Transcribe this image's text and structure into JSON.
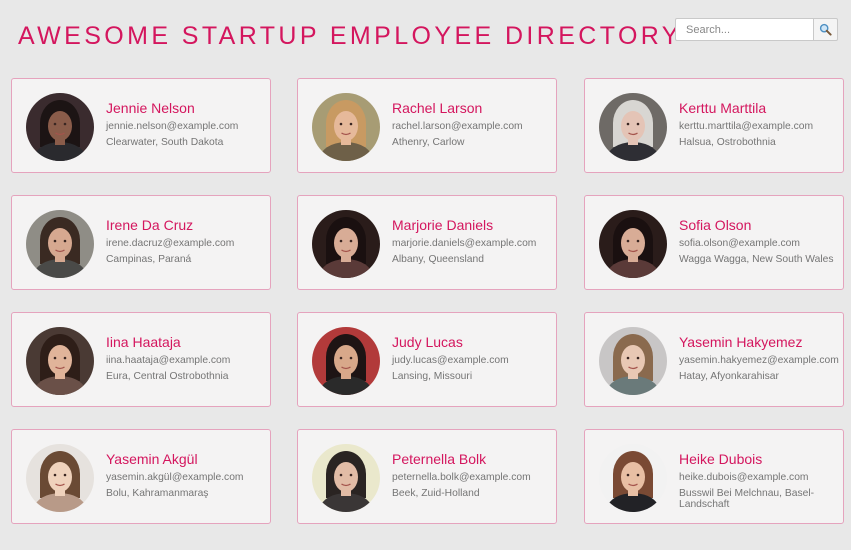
{
  "header": {
    "title": "Awesome Startup Employee Directory"
  },
  "search": {
    "placeholder": "Search...",
    "value": "",
    "button_icon": "magnifier-icon"
  },
  "colors": {
    "accent": "#d4165e",
    "card_border": "#e5a3bd",
    "card_background": "#f4f3f3",
    "page_background": "#e8e8e8"
  },
  "employees": [
    {
      "name": "Jennie Nelson",
      "email": "jennie.nelson@example.com",
      "location": "Clearwater, South Dakota",
      "photo": {
        "bg": "#3a2b2e",
        "hair": "#1c1414",
        "skin": "#8a5c4a",
        "shirt": "#2a2a2e"
      }
    },
    {
      "name": "Rachel Larson",
      "email": "rachel.larson@example.com",
      "location": "Athenry, Carlow",
      "photo": {
        "bg": "#a79c74",
        "hair": "#c89a62",
        "skin": "#e6b99a",
        "shirt": "#6e6048"
      }
    },
    {
      "name": "Kerttu Marttila",
      "email": "kerttu.marttila@example.com",
      "location": "Halsua, Ostrobothnia",
      "photo": {
        "bg": "#6e6a66",
        "hair": "#d8d6d2",
        "skin": "#e4c4b6",
        "shirt": "#2e2e34"
      }
    },
    {
      "name": "Irene Da Cruz",
      "email": "irene.dacruz@example.com",
      "location": "Campinas, Paraná",
      "photo": {
        "bg": "#8f8d86",
        "hair": "#3a2a22",
        "skin": "#d6a890",
        "shirt": "#4a4a48"
      }
    },
    {
      "name": "Marjorie Daniels",
      "email": "marjorie.daniels@example.com",
      "location": "Albany, Queensland",
      "photo": {
        "bg": "#2a1c1a",
        "hair": "#1a1010",
        "skin": "#d8ac96",
        "shirt": "#5a3a38"
      }
    },
    {
      "name": "Sofia Olson",
      "email": "sofia.olson@example.com",
      "location": "Wagga Wagga, New South Wales",
      "photo": {
        "bg": "#2a1c1a",
        "hair": "#1a1010",
        "skin": "#d8ac96",
        "shirt": "#5a3a38"
      }
    },
    {
      "name": "Iina Haataja",
      "email": "iina.haataja@example.com",
      "location": "Eura, Central Ostrobothnia",
      "photo": {
        "bg": "#4a3a34",
        "hair": "#2e1e18",
        "skin": "#e0b49a",
        "shirt": "#6a5048"
      }
    },
    {
      "name": "Judy Lucas",
      "email": "judy.lucas@example.com",
      "location": "Lansing, Missouri",
      "photo": {
        "bg": "#b23a3a",
        "hair": "#1e1414",
        "skin": "#d8a88a",
        "shirt": "#2a2a2a"
      }
    },
    {
      "name": "Yasemin Hakyemez",
      "email": "yasemin.hakyemez@example.com",
      "location": "Hatay, Afyonkarahisar",
      "photo": {
        "bg": "#c8c6c6",
        "hair": "#8a6a4e",
        "skin": "#e8c8b4",
        "shirt": "#6a7a7a"
      }
    },
    {
      "name": "Yasemin Akgül",
      "email": "yasemin.akgül@example.com",
      "location": "Bolu, Kahramanmaraş",
      "photo": {
        "bg": "#e6e2de",
        "hair": "#6a4a34",
        "skin": "#efd2bc",
        "shirt": "#b89a88"
      }
    },
    {
      "name": "Peternella Bolk",
      "email": "peternella.bolk@example.com",
      "location": "Beek, Zuid-Holland",
      "photo": {
        "bg": "#eae8cc",
        "hair": "#2a2422",
        "skin": "#e2bca6",
        "shirt": "#3a3636"
      }
    },
    {
      "name": "Heike Dubois",
      "email": "heike.dubois@example.com",
      "location": "Busswil Bei Melchnau, Basel-Landschaft",
      "photo": {
        "bg": "#f2f2f2",
        "hair": "#7a4a34",
        "skin": "#e8bfa4",
        "shirt": "#222226"
      }
    }
  ]
}
